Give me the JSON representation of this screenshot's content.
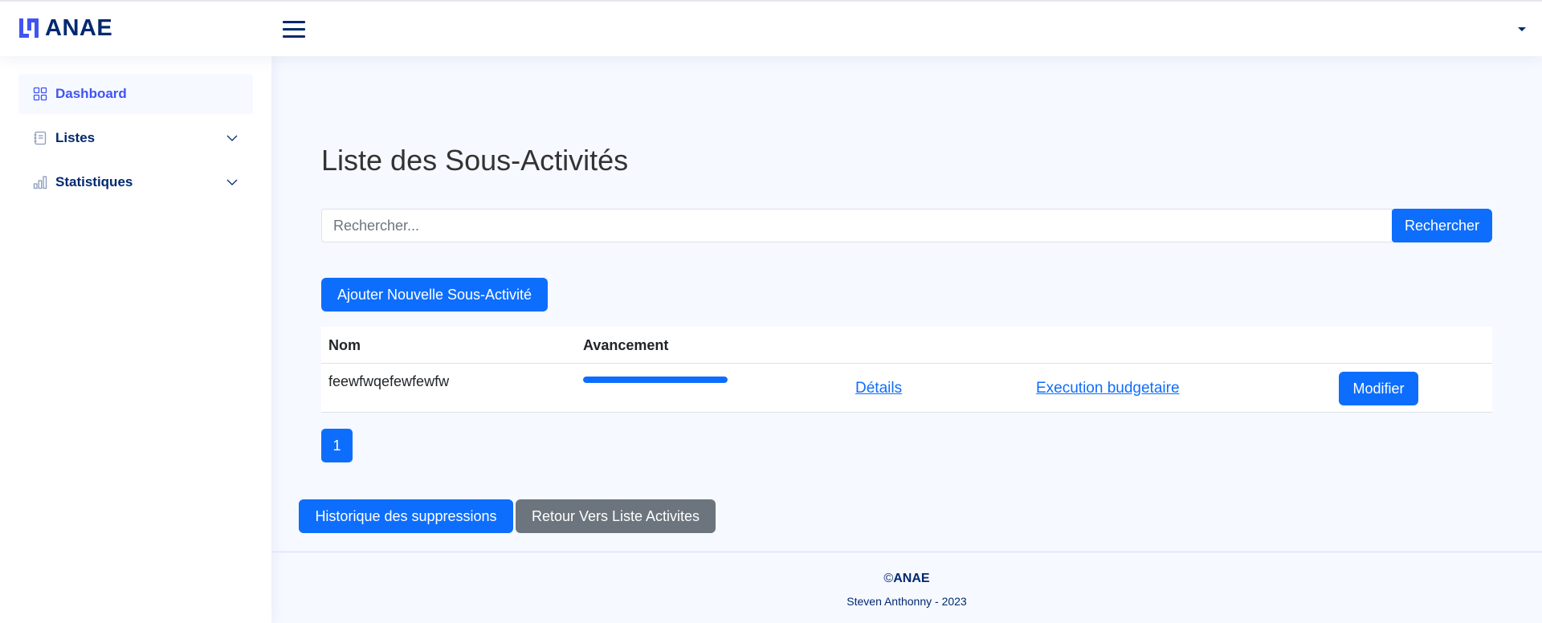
{
  "header": {
    "logo_text": "ANAE",
    "menu_toggle": "menu-toggle"
  },
  "sidebar": {
    "items": [
      {
        "label": "Dashboard",
        "icon": "grid-icon",
        "active": true
      },
      {
        "label": "Listes",
        "icon": "journal-icon",
        "expandable": true
      },
      {
        "label": "Statistiques",
        "icon": "bar-chart-icon",
        "expandable": true
      }
    ]
  },
  "main": {
    "title": "Liste des Sous-Activités",
    "search": {
      "placeholder": "Rechercher...",
      "value": "",
      "button_label": "Rechercher"
    },
    "add_button_label": "Ajouter Nouvelle Sous-Activité",
    "table": {
      "columns": [
        "Nom",
        "Avancement"
      ],
      "rows": [
        {
          "name": "feewfwqefewfewfw",
          "progress": 1.0,
          "details_label": "Détails",
          "budget_label": "Execution budgetaire",
          "modify_label": "Modifier"
        }
      ]
    },
    "pagination": {
      "current": "1"
    },
    "history_button_label": "Historique des suppressions",
    "back_button_label": "Retour Vers Liste Activites"
  },
  "footer": {
    "copyright_symbol": "©",
    "brand": "ANAE",
    "credits": "Steven Anthonny - 2023"
  },
  "colors": {
    "primary": "#0d6efd",
    "secondary": "#6c757d",
    "navy": "#012970",
    "accent": "#4154f1"
  }
}
